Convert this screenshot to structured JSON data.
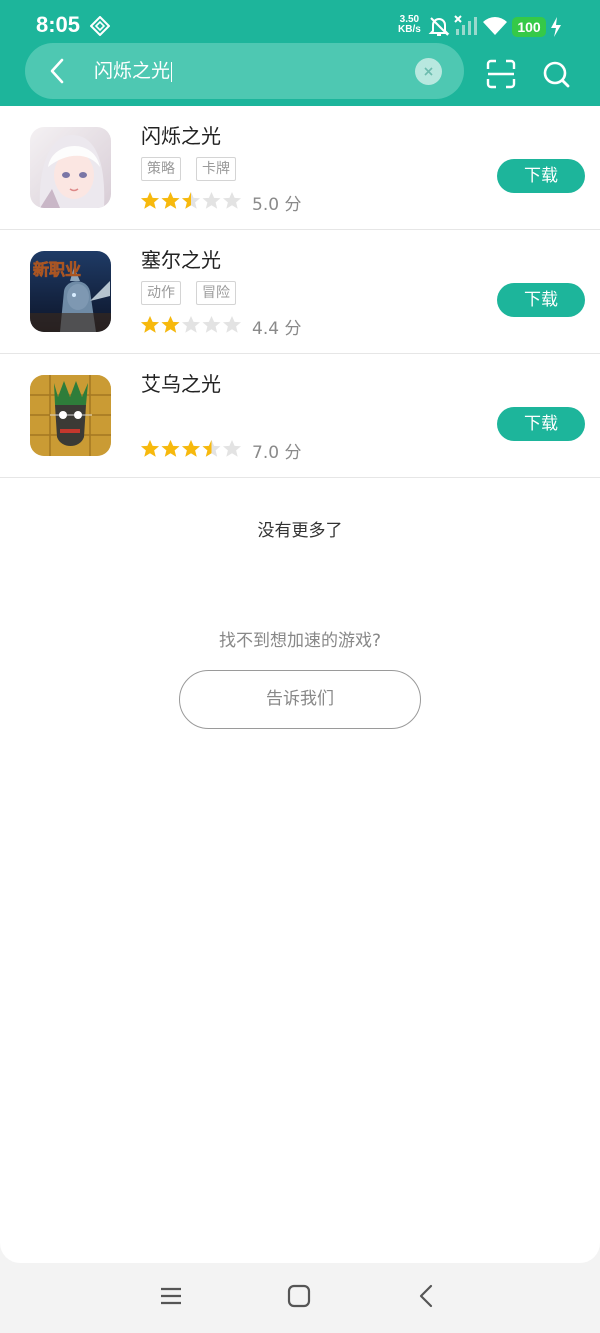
{
  "status_bar": {
    "time": "8:05",
    "net_speed_value": "3.50",
    "net_speed_unit": "KB/s",
    "battery": "100"
  },
  "search": {
    "query": "闪烁之光"
  },
  "results": [
    {
      "title": "闪烁之光",
      "tags": [
        "策略",
        "卡牌"
      ],
      "stars": 2.5,
      "score": "5.0 分",
      "button": "下载"
    },
    {
      "title": "塞尔之光",
      "tags": [
        "动作",
        "冒险"
      ],
      "stars": 2,
      "score": "4.4 分",
      "button": "下载"
    },
    {
      "title": "艾乌之光",
      "tags": [],
      "stars": 3.5,
      "score": "7.0 分",
      "button": "下载"
    }
  ],
  "icons": {
    "game2_badge": "新职业"
  },
  "footer": {
    "no_more": "没有更多了",
    "cant_find": "找不到想加速的游戏?",
    "tell_us": "告诉我们"
  },
  "colors": {
    "accent": "#1db59b",
    "star": "#f7b90d",
    "star_empty": "#e3e3e3"
  }
}
